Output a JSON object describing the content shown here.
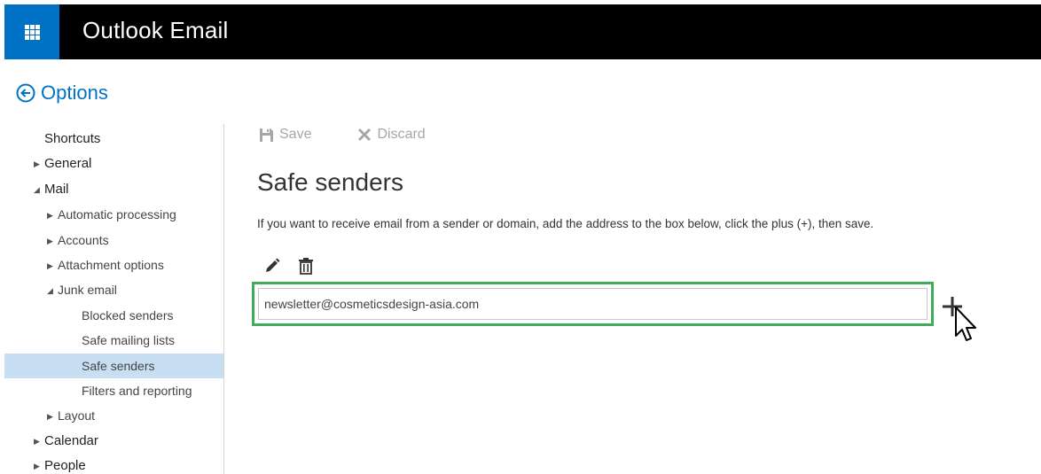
{
  "header": {
    "app_title": "Outlook Email",
    "waffle_icon": "app-launcher-icon",
    "waffle_color": "#0072c6"
  },
  "options_link": {
    "label": "Options",
    "icon": "back-arrow-icon"
  },
  "sidebar": {
    "items": [
      {
        "label": "Shortcuts",
        "level": 1,
        "expand": "none"
      },
      {
        "label": "General",
        "level": 1,
        "expand": "collapsed"
      },
      {
        "label": "Mail",
        "level": 1,
        "expand": "expanded"
      },
      {
        "label": "Automatic processing",
        "level": 2,
        "expand": "collapsed"
      },
      {
        "label": "Accounts",
        "level": 2,
        "expand": "collapsed"
      },
      {
        "label": "Attachment options",
        "level": 2,
        "expand": "collapsed"
      },
      {
        "label": "Junk email",
        "level": 2,
        "expand": "expanded"
      },
      {
        "label": "Blocked senders",
        "level": 3,
        "expand": "none"
      },
      {
        "label": "Safe mailing lists",
        "level": 3,
        "expand": "none"
      },
      {
        "label": "Safe senders",
        "level": 3,
        "expand": "none",
        "selected": true
      },
      {
        "label": "Filters and reporting",
        "level": 3,
        "expand": "none"
      },
      {
        "label": "Layout",
        "level": 2,
        "expand": "collapsed"
      },
      {
        "label": "Calendar",
        "level": 1,
        "expand": "collapsed"
      },
      {
        "label": "People",
        "level": 1,
        "expand": "collapsed"
      }
    ]
  },
  "toolbar": {
    "save_label": "Save",
    "discard_label": "Discard"
  },
  "main": {
    "title": "Safe senders",
    "description": "If you want to receive email from a sender or domain, add the address to the box below, click the plus (+), then save.",
    "input_value": "newsletter@cosmeticsdesign-asia.com",
    "highlight_color": "#3fac5a",
    "add_label": "+"
  },
  "colors": {
    "accent": "#0072c6",
    "selected_bg": "#c7def3",
    "topbar": "#000000"
  }
}
